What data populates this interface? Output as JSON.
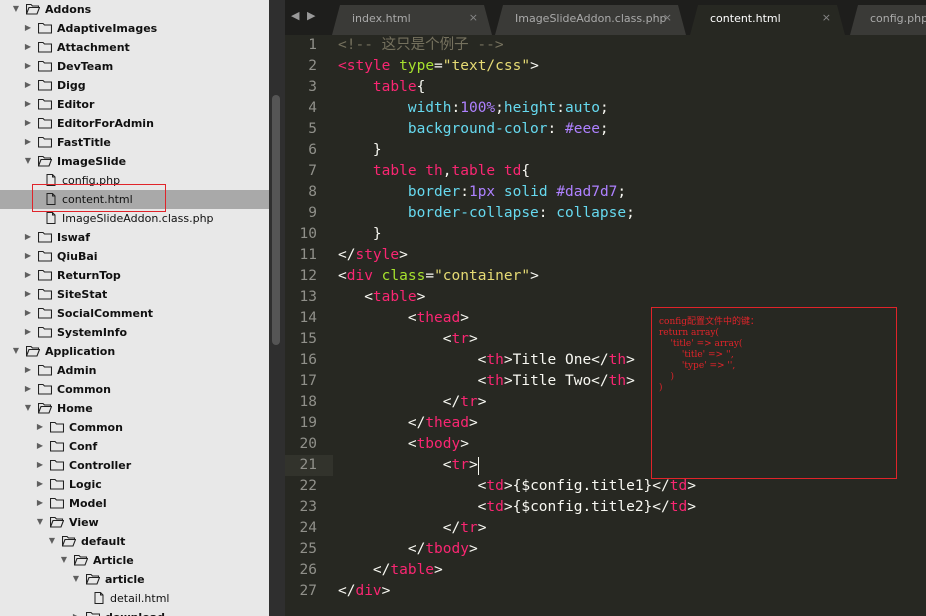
{
  "sidebar": {
    "rows": [
      {
        "label": "Addons",
        "type": "folder",
        "state": "open",
        "depth": 0
      },
      {
        "label": "AdaptiveImages",
        "type": "folder",
        "state": "closed",
        "depth": 1
      },
      {
        "label": "Attachment",
        "type": "folder",
        "state": "closed",
        "depth": 1
      },
      {
        "label": "DevTeam",
        "type": "folder",
        "state": "closed",
        "depth": 1
      },
      {
        "label": "Digg",
        "type": "folder",
        "state": "closed",
        "depth": 1
      },
      {
        "label": "Editor",
        "type": "folder",
        "state": "closed",
        "depth": 1
      },
      {
        "label": "EditorForAdmin",
        "type": "folder",
        "state": "closed",
        "depth": 1
      },
      {
        "label": "FastTitle",
        "type": "folder",
        "state": "closed",
        "depth": 1
      },
      {
        "label": "ImageSlide",
        "type": "folder",
        "state": "open",
        "depth": 1
      },
      {
        "label": "config.php",
        "type": "file",
        "depth": 2
      },
      {
        "label": "content.html",
        "type": "file",
        "depth": 2,
        "selected": true
      },
      {
        "label": "ImageSlideAddon.class.php",
        "type": "file",
        "depth": 2
      },
      {
        "label": "Iswaf",
        "type": "folder",
        "state": "closed",
        "depth": 1
      },
      {
        "label": "QiuBai",
        "type": "folder",
        "state": "closed",
        "depth": 1
      },
      {
        "label": "ReturnTop",
        "type": "folder",
        "state": "closed",
        "depth": 1
      },
      {
        "label": "SiteStat",
        "type": "folder",
        "state": "closed",
        "depth": 1
      },
      {
        "label": "SocialComment",
        "type": "folder",
        "state": "closed",
        "depth": 1
      },
      {
        "label": "SystemInfo",
        "type": "folder",
        "state": "closed",
        "depth": 1
      },
      {
        "label": "Application",
        "type": "folder",
        "state": "open",
        "depth": 0
      },
      {
        "label": "Admin",
        "type": "folder",
        "state": "closed",
        "depth": 1
      },
      {
        "label": "Common",
        "type": "folder",
        "state": "closed",
        "depth": 1
      },
      {
        "label": "Home",
        "type": "folder",
        "state": "open",
        "depth": 1
      },
      {
        "label": "Common",
        "type": "folder",
        "state": "closed",
        "depth": 2
      },
      {
        "label": "Conf",
        "type": "folder",
        "state": "closed",
        "depth": 2
      },
      {
        "label": "Controller",
        "type": "folder",
        "state": "closed",
        "depth": 2
      },
      {
        "label": "Logic",
        "type": "folder",
        "state": "closed",
        "depth": 2
      },
      {
        "label": "Model",
        "type": "folder",
        "state": "closed",
        "depth": 2
      },
      {
        "label": "View",
        "type": "folder",
        "state": "open",
        "depth": 2
      },
      {
        "label": "default",
        "type": "folder",
        "state": "open",
        "depth": 3
      },
      {
        "label": "Article",
        "type": "folder",
        "state": "open",
        "depth": 4
      },
      {
        "label": "article",
        "type": "folder",
        "state": "open",
        "depth": 5
      },
      {
        "label": "detail.html",
        "type": "file",
        "depth": 6
      },
      {
        "label": "download",
        "type": "folder",
        "state": "closed",
        "depth": 5
      }
    ]
  },
  "tabs": [
    {
      "label": "index.html",
      "active": false,
      "close": "×"
    },
    {
      "label": "ImageSlideAddon.class.php",
      "active": false,
      "close": "×"
    },
    {
      "label": "content.html",
      "active": true,
      "close": "×"
    },
    {
      "label": "config.php",
      "active": false,
      "close": "×"
    }
  ],
  "tab_nav": {
    "back": "◀",
    "forward": "▶"
  },
  "editor": {
    "current_line": 21,
    "lines": [
      [
        [
          "cm",
          "<!-- 这只是个例子 -->"
        ]
      ],
      [
        [
          "tg",
          "<style"
        ],
        [
          "pl",
          " "
        ],
        [
          "at",
          "type"
        ],
        [
          "pl",
          "="
        ],
        [
          "st",
          "\"text/css\""
        ],
        [
          "pl",
          ">"
        ]
      ],
      [
        [
          "pl",
          "    "
        ],
        [
          "tg",
          "table"
        ],
        [
          "pl",
          "{"
        ]
      ],
      [
        [
          "pl",
          "        "
        ],
        [
          "pr",
          "width"
        ],
        [
          "pl",
          ":"
        ],
        [
          "nu",
          "100%"
        ],
        [
          "pl",
          ";"
        ],
        [
          "pr",
          "height"
        ],
        [
          "pl",
          ":"
        ],
        [
          "pr",
          "auto"
        ],
        [
          "pl",
          ";"
        ]
      ],
      [
        [
          "pl",
          "        "
        ],
        [
          "pr",
          "background-color"
        ],
        [
          "pl",
          ": "
        ],
        [
          "nu",
          "#eee"
        ],
        [
          "pl",
          ";"
        ]
      ],
      [
        [
          "pl",
          "    }"
        ]
      ],
      [
        [
          "pl",
          "    "
        ],
        [
          "tg",
          "table th"
        ],
        [
          "pl",
          ","
        ],
        [
          "tg",
          "table td"
        ],
        [
          "pl",
          "{"
        ]
      ],
      [
        [
          "pl",
          "        "
        ],
        [
          "pr",
          "border"
        ],
        [
          "pl",
          ":"
        ],
        [
          "nu",
          "1px"
        ],
        [
          "pl",
          " "
        ],
        [
          "pr",
          "solid"
        ],
        [
          "pl",
          " "
        ],
        [
          "nu",
          "#dad7d7"
        ],
        [
          "pl",
          ";"
        ]
      ],
      [
        [
          "pl",
          "        "
        ],
        [
          "pr",
          "border-collapse"
        ],
        [
          "pl",
          ": "
        ],
        [
          "pr",
          "collapse"
        ],
        [
          "pl",
          ";"
        ]
      ],
      [
        [
          "pl",
          "    }"
        ]
      ],
      [
        [
          "pl",
          "</"
        ],
        [
          "tg",
          "style"
        ],
        [
          "pl",
          ">"
        ]
      ],
      [
        [
          "pl",
          "<"
        ],
        [
          "tg",
          "div"
        ],
        [
          "pl",
          " "
        ],
        [
          "at",
          "class"
        ],
        [
          "pl",
          "="
        ],
        [
          "st",
          "\"container\""
        ],
        [
          "pl",
          ">"
        ]
      ],
      [
        [
          "pl",
          "   <"
        ],
        [
          "tg",
          "table"
        ],
        [
          "pl",
          ">"
        ]
      ],
      [
        [
          "pl",
          "        <"
        ],
        [
          "tg",
          "thead"
        ],
        [
          "pl",
          ">"
        ]
      ],
      [
        [
          "pl",
          "            <"
        ],
        [
          "tg",
          "tr"
        ],
        [
          "pl",
          ">"
        ]
      ],
      [
        [
          "pl",
          "                <"
        ],
        [
          "tg",
          "th"
        ],
        [
          "pl",
          ">Title One</"
        ],
        [
          "tg",
          "th"
        ],
        [
          "pl",
          ">"
        ]
      ],
      [
        [
          "pl",
          "                <"
        ],
        [
          "tg",
          "th"
        ],
        [
          "pl",
          ">Title Two</"
        ],
        [
          "tg",
          "th"
        ],
        [
          "pl",
          ">"
        ]
      ],
      [
        [
          "pl",
          "            </"
        ],
        [
          "tg",
          "tr"
        ],
        [
          "pl",
          ">"
        ]
      ],
      [
        [
          "pl",
          "        </"
        ],
        [
          "tg",
          "thead"
        ],
        [
          "pl",
          ">"
        ]
      ],
      [
        [
          "pl",
          "        <"
        ],
        [
          "tg",
          "tbody"
        ],
        [
          "pl",
          ">"
        ]
      ],
      [
        [
          "pl",
          "            <"
        ],
        [
          "tg",
          "tr"
        ],
        [
          "pl",
          ">"
        ]
      ],
      [
        [
          "pl",
          "                <"
        ],
        [
          "tg",
          "td"
        ],
        [
          "pl",
          ">{$config.title1}</"
        ],
        [
          "tg",
          "td"
        ],
        [
          "pl",
          ">"
        ]
      ],
      [
        [
          "pl",
          "                <"
        ],
        [
          "tg",
          "td"
        ],
        [
          "pl",
          ">{$config.title2}</"
        ],
        [
          "tg",
          "td"
        ],
        [
          "pl",
          ">"
        ]
      ],
      [
        [
          "pl",
          "            </"
        ],
        [
          "tg",
          "tr"
        ],
        [
          "pl",
          ">"
        ]
      ],
      [
        [
          "pl",
          "        </"
        ],
        [
          "tg",
          "tbody"
        ],
        [
          "pl",
          ">"
        ]
      ],
      [
        [
          "pl",
          "    </"
        ],
        [
          "tg",
          "table"
        ],
        [
          "pl",
          ">"
        ]
      ],
      [
        [
          "pl",
          "</"
        ],
        [
          "tg",
          "div"
        ],
        [
          "pl",
          ">"
        ]
      ]
    ]
  },
  "annotation": {
    "lines": [
      "config配置文件中的键：",
      "return array(",
      "    'title' => array(",
      "        'title' => '',",
      "        'type' => '',",
      "    )",
      ")"
    ]
  },
  "colors": {
    "editor_bg": "#272822",
    "tag": "#f92672",
    "attribute": "#a6e22e",
    "string": "#e6db74",
    "property": "#66d9ef",
    "number": "#ae81ff",
    "comment": "#75715e",
    "annotation": "#e0242a"
  }
}
